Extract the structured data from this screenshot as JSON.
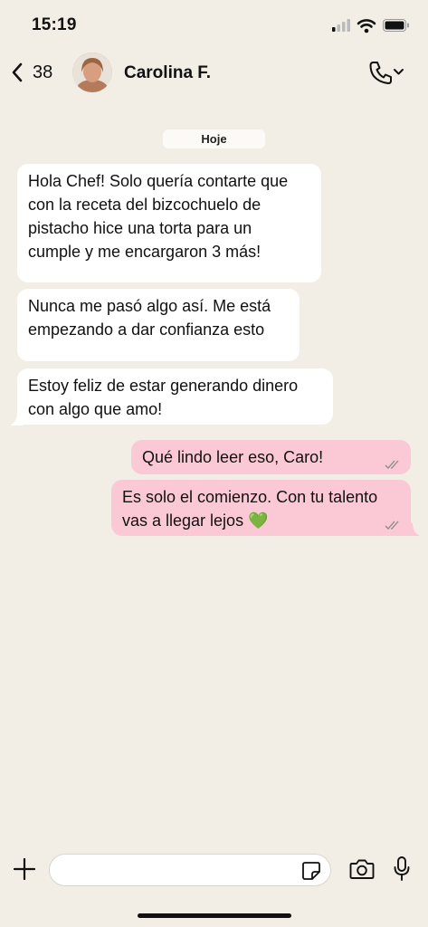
{
  "status_bar": {
    "time": "15:19",
    "icons": [
      "cellular-signal-icon",
      "wifi-icon",
      "battery-icon"
    ]
  },
  "header": {
    "back_count": "38",
    "contact_name": "Carolina F.",
    "icons": [
      "chevron-left-icon",
      "phone-icon",
      "chevron-down-icon"
    ]
  },
  "chat": {
    "date_label": "Hoje",
    "messages": [
      {
        "direction": "incoming",
        "lines": [
          "Hola Chef! Solo quería contarte que",
          "con la receta del bizcochuelo de",
          "pistacho hice una torta para un",
          "cumple y me encargaron 3 más!"
        ]
      },
      {
        "direction": "incoming",
        "lines": [
          "Nunca me pasó algo así. Me está",
          "empezando a dar confianza esto"
        ]
      },
      {
        "direction": "incoming",
        "lines": [
          "Estoy feliz de estar generando dinero",
          "con algo que amo!"
        ]
      },
      {
        "direction": "outgoing",
        "lines": [
          "Qué lindo leer eso, Caro!"
        ],
        "status": "read"
      },
      {
        "direction": "outgoing",
        "lines": [
          "Es solo el comienzo. Con tu talento",
          "vas a llegar lejos 💚"
        ],
        "status": "read"
      }
    ]
  },
  "input_bar": {
    "placeholder": "",
    "icons": [
      "plus-icon",
      "sticker-icon",
      "camera-icon",
      "microphone-icon"
    ]
  },
  "colors": {
    "background": "#f2eee6",
    "incoming_bubble": "#ffffff",
    "outgoing_bubble": "#fbc9d6",
    "text": "#111111"
  }
}
